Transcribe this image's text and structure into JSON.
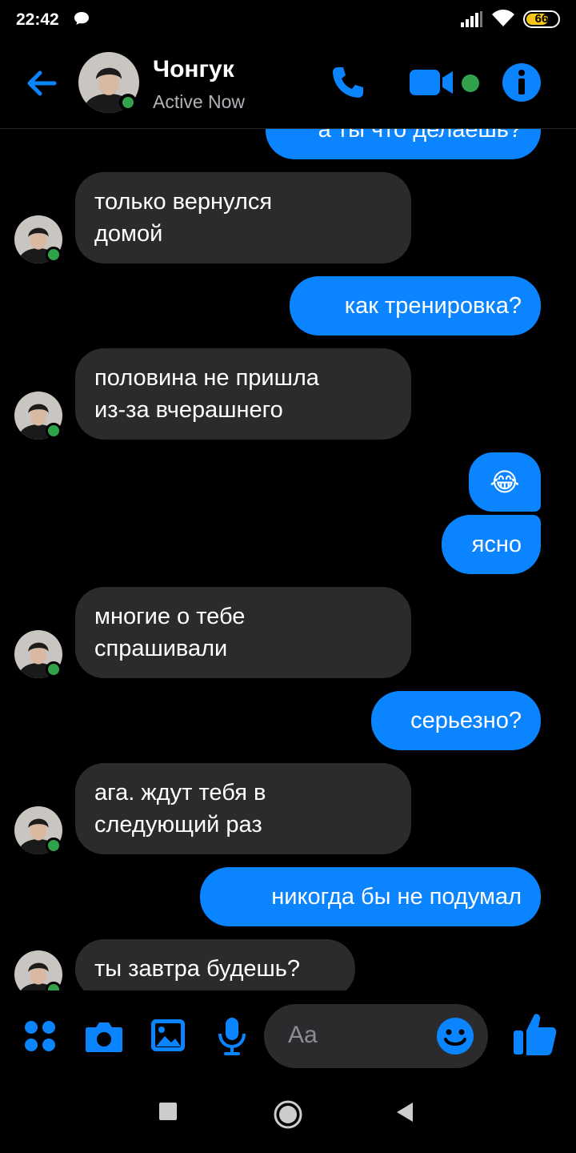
{
  "status_bar": {
    "time": "22:42",
    "battery": "66",
    "icons": [
      "chat-bubble-icon",
      "signal-icon",
      "wifi-icon",
      "battery-icon"
    ]
  },
  "header": {
    "name": "Чонгук",
    "status": "Active Now",
    "icons": [
      "back-arrow-icon",
      "phone-icon",
      "video-icon",
      "info-icon"
    ]
  },
  "messages": [
    {
      "from": "me",
      "text": "а ты что делаешь?"
    },
    {
      "from": "them",
      "lines": [
        "только вернулся",
        "домой"
      ]
    },
    {
      "from": "me",
      "text": "как тренировка?"
    },
    {
      "from": "them",
      "lines": [
        "половина не пришла",
        "из-за вчерашнего"
      ]
    },
    {
      "from": "me",
      "emoji": "😂"
    },
    {
      "from": "me",
      "text": "ясно"
    },
    {
      "from": "them",
      "lines": [
        "многие о тебе",
        "спрашивали"
      ]
    },
    {
      "from": "me",
      "text": "серьезно?"
    },
    {
      "from": "them",
      "lines": [
        "ага. ждут тебя в",
        "следующий раз"
      ]
    },
    {
      "from": "me",
      "text": "никогда бы не подумал"
    },
    {
      "from": "them",
      "lines": [
        "ты завтра будешь?"
      ]
    }
  ],
  "composer": {
    "placeholder": "Aa",
    "icons": [
      "apps-grid-icon",
      "camera-icon",
      "gallery-icon",
      "microphone-icon",
      "emoji-icon",
      "like-thumb-icon"
    ]
  },
  "colors": {
    "accent": "#0a84ff",
    "online": "#31a24c",
    "incoming_bubble": "#2b2b2d",
    "background": "#000000"
  },
  "navbar": {
    "icons": [
      "recents-square-icon",
      "home-circle-icon",
      "back-triangle-icon"
    ]
  }
}
